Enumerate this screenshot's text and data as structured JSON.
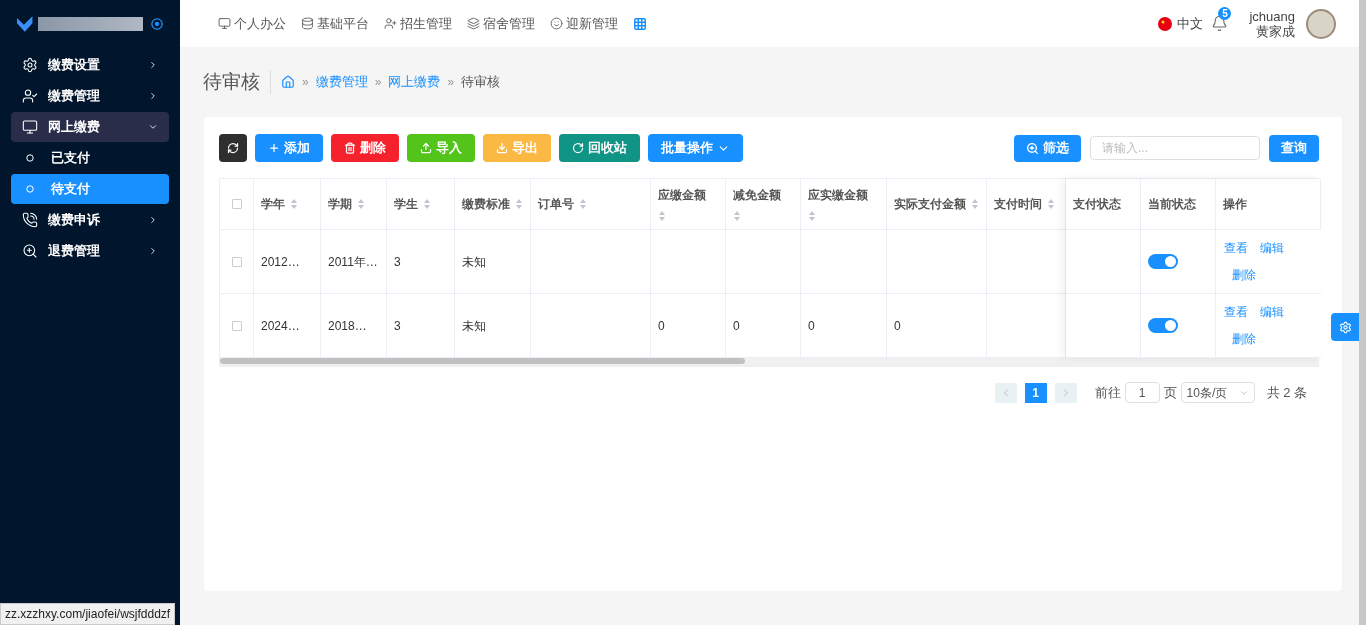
{
  "sidebar": {
    "items": [
      {
        "label": "缴费设置",
        "expanded": false
      },
      {
        "label": "缴费管理",
        "expanded": false
      },
      {
        "label": "网上缴费",
        "expanded": true,
        "children": [
          {
            "label": "已支付",
            "selected": false
          },
          {
            "label": "待支付",
            "selected": true
          }
        ]
      },
      {
        "label": "缴费申诉",
        "expanded": false
      },
      {
        "label": "退费管理",
        "expanded": false
      }
    ]
  },
  "topnav": [
    {
      "label": "个人办公"
    },
    {
      "label": "基础平台"
    },
    {
      "label": "招生管理"
    },
    {
      "label": "宿舍管理"
    },
    {
      "label": "迎新管理"
    }
  ],
  "header": {
    "language": "中文",
    "notifications": "5",
    "username": "jchuang",
    "display_name": "黄家成"
  },
  "page_title": "待审核",
  "breadcrumb": [
    {
      "separator": "»",
      "label": "缴费管理",
      "link": true
    },
    {
      "separator": "»",
      "label": "网上缴费",
      "link": true
    },
    {
      "separator": "»",
      "label": "待审核",
      "link": false
    }
  ],
  "toolbar": {
    "buttons": [
      {
        "kind": "refresh"
      },
      {
        "label": "添加",
        "kind": "add"
      },
      {
        "label": "删除",
        "kind": "delete"
      },
      {
        "label": "导入",
        "kind": "import"
      },
      {
        "label": "导出",
        "kind": "export"
      },
      {
        "label": "回收站",
        "kind": "recycle"
      },
      {
        "label": "批量操作",
        "kind": "batch"
      }
    ],
    "filter_button": "筛选",
    "search": {
      "placeholder": "请输入..."
    },
    "query_button": "查询"
  },
  "table": {
    "header_checked": false,
    "columns": [
      {
        "label": "学年",
        "sortable": true
      },
      {
        "label": "学期",
        "sortable": true
      },
      {
        "label": "学生",
        "sortable": true
      },
      {
        "label": "缴费标准",
        "sortable": true
      },
      {
        "label": "订单号",
        "sortable": true
      },
      {
        "label": "应缴金额",
        "sortable": true
      },
      {
        "label": "减免金额",
        "sortable": true
      },
      {
        "label": "应实缴金额",
        "sortable": true
      },
      {
        "label": "实际支付金额",
        "sortable": true
      },
      {
        "label": "支付时间",
        "sortable": true
      },
      {
        "label": "支付状态",
        "sortable": false
      },
      {
        "label": "当前状态",
        "sortable": false
      },
      {
        "label": "操作",
        "sortable": false
      }
    ],
    "rows": [
      {
        "cells": [
          "2012…",
          "2011年…",
          "3",
          "未知",
          "",
          "",
          "",
          "",
          "",
          ""
        ],
        "checked": false,
        "on": true,
        "actions": [
          "查看",
          "编辑",
          "删除"
        ]
      },
      {
        "cells": [
          "2024…",
          "2018…",
          "3",
          "未知",
          "",
          "0",
          "0",
          "0",
          "0",
          ""
        ],
        "checked": false,
        "on": true,
        "actions": [
          "查看",
          "编辑",
          "删除"
        ]
      }
    ]
  },
  "pagination": {
    "pages": [
      {
        "label": "1",
        "selected": true
      }
    ],
    "goto_label": "前往",
    "goto_value": "1",
    "page_suffix": "页",
    "page_size": "10条/页",
    "total": "共 2 条"
  },
  "status_url": "zz.xzzhxy.com/jiaofei/wsjfdddzf"
}
